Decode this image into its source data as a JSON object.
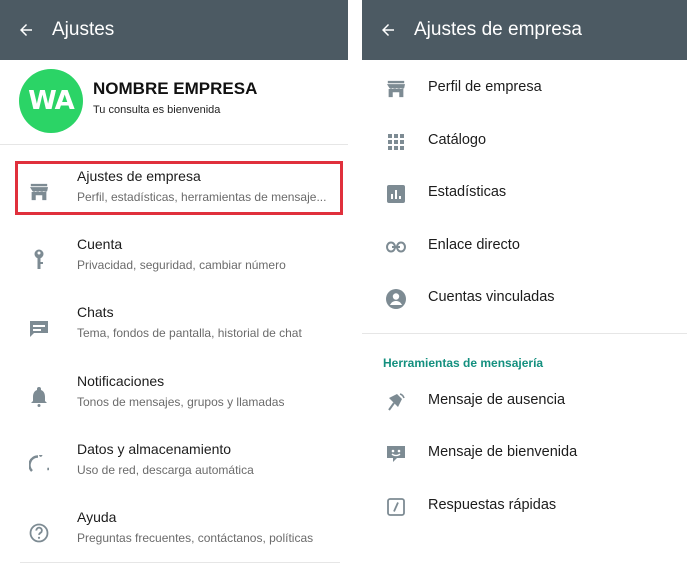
{
  "left": {
    "appbar": {
      "title": "Ajustes"
    },
    "profile": {
      "avatar_text": "WA",
      "name": "NOMBRE EMPRESA",
      "status": "Tu consulta es bienvenida"
    },
    "items": [
      {
        "title": "Ajustes de empresa",
        "subtitle": "Perfil, estadísticas, herramientas de mensaje...",
        "icon": "store-icon"
      },
      {
        "title": "Cuenta",
        "subtitle": "Privacidad, seguridad, cambiar número",
        "icon": "key-icon"
      },
      {
        "title": "Chats",
        "subtitle": "Tema, fondos de pantalla, historial de chat",
        "icon": "chat-icon"
      },
      {
        "title": "Notificaciones",
        "subtitle": "Tonos de mensajes, grupos y llamadas",
        "icon": "bell-icon"
      },
      {
        "title": "Datos y almacenamiento",
        "subtitle": "Uso de red, descarga automática",
        "icon": "data-usage-icon"
      },
      {
        "title": "Ayuda",
        "subtitle": "Preguntas frecuentes, contáctanos, políticas",
        "icon": "help-icon"
      }
    ]
  },
  "right": {
    "appbar": {
      "title": "Ajustes de empresa"
    },
    "items": [
      {
        "label": "Perfil de empresa",
        "icon": "store-icon"
      },
      {
        "label": "Catálogo",
        "icon": "grid-icon"
      },
      {
        "label": "Estadísticas",
        "icon": "bar-chart-icon"
      },
      {
        "label": "Enlace directo",
        "icon": "link-icon"
      },
      {
        "label": "Cuentas vinculadas",
        "icon": "account-circle-icon"
      }
    ],
    "section_title": "Herramientas de mensajería",
    "tools": [
      {
        "label": "Mensaje de ausencia",
        "icon": "away-icon"
      },
      {
        "label": "Mensaje de bienvenida",
        "icon": "greeting-icon"
      },
      {
        "label": "Respuestas rápidas",
        "icon": "quick-reply-icon"
      }
    ]
  },
  "colors": {
    "appbar": "#4c5a63",
    "accent_green": "#2bd466",
    "section_teal": "#14907f",
    "highlight_red": "#e0303c",
    "icon_gray": "#7d8b93"
  }
}
